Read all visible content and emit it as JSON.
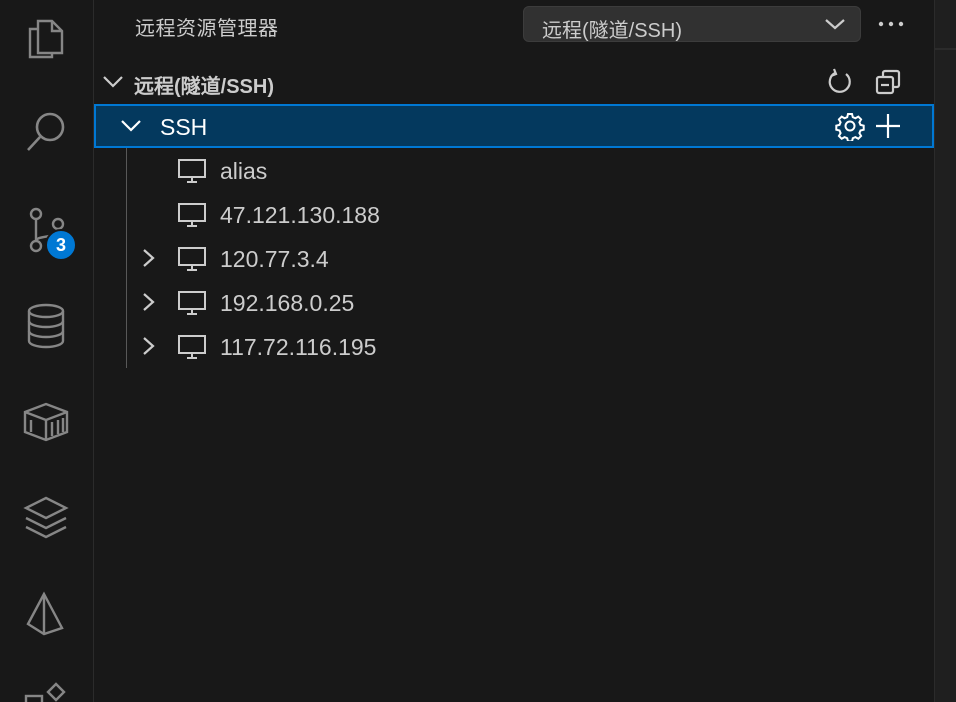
{
  "activity_bar": {
    "icons": [
      "explorer-icon",
      "search-icon",
      "source-control-icon",
      "database-icon",
      "container-icon",
      "layers-icon",
      "prisma-icon",
      "extensions-icon"
    ],
    "source_control_badge": "3"
  },
  "header": {
    "title": "远程资源管理器",
    "selected_view": "远程(隧道/SSH)"
  },
  "section": {
    "title": "远程(隧道/SSH)"
  },
  "tree": {
    "root": {
      "label": "SSH",
      "expanded": true
    },
    "hosts": [
      {
        "label": "alias",
        "expandable": false
      },
      {
        "label": "47.121.130.188",
        "expandable": false
      },
      {
        "label": "120.77.3.4",
        "expandable": true
      },
      {
        "label": "192.168.0.25",
        "expandable": true
      },
      {
        "label": "117.72.116.195",
        "expandable": true
      }
    ]
  },
  "colors": {
    "accent": "#0078d4",
    "selection_bg": "#04395e",
    "background": "#181818",
    "foreground": "#cccccc"
  }
}
